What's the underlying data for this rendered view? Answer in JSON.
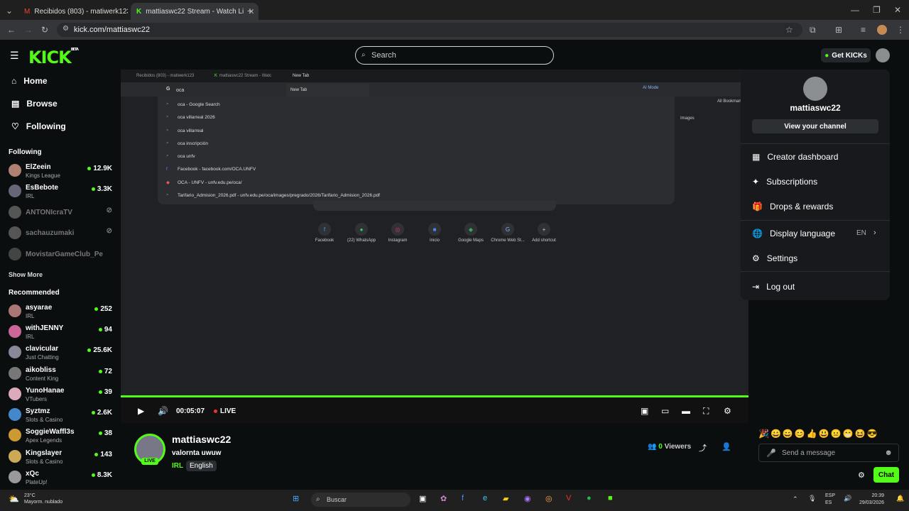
{
  "browser": {
    "tabs": [
      {
        "title": "Recibidos (803) - matiwerk123",
        "active": false
      },
      {
        "title": "mattiaswc22 Stream - Watch Li",
        "active": true
      }
    ],
    "url": "kick.com/mattiaswc22"
  },
  "kick": {
    "logo": "KICK",
    "logo_badge": "BETA",
    "search_placeholder": "Search",
    "get_kicks": "Get KICKs",
    "nav": [
      {
        "label": "Home",
        "icon": "home-icon"
      },
      {
        "label": "Browse",
        "icon": "browse-icon"
      },
      {
        "label": "Following",
        "icon": "heart-icon"
      }
    ],
    "following_header": "Following",
    "following": [
      {
        "name": "ElZeein",
        "category": "Kings League",
        "viewers": "12.9K",
        "live": true
      },
      {
        "name": "EsBebote",
        "category": "IRL",
        "viewers": "3.3K",
        "live": true
      },
      {
        "name": "ANTONIcraTV",
        "live": false
      },
      {
        "name": "sachauzumaki",
        "live": false
      },
      {
        "name": "MovistarGameClub_Pe",
        "live": false
      }
    ],
    "show_more": "Show More",
    "recommended_header": "Recommended",
    "recommended": [
      {
        "name": "asyarae",
        "category": "IRL",
        "viewers": "252"
      },
      {
        "name": "withJENNY",
        "category": "IRL",
        "viewers": "94"
      },
      {
        "name": "clavicular",
        "category": "Just Chatting",
        "viewers": "25.6K"
      },
      {
        "name": "aikobliss",
        "category": "Content King",
        "viewers": "72"
      },
      {
        "name": "YunoHanae",
        "category": "VTubers",
        "viewers": "39"
      },
      {
        "name": "Syztmz",
        "category": "Slots & Casino",
        "viewers": "2.6K"
      },
      {
        "name": "SoggieWaffl3s",
        "category": "Apex Legends",
        "viewers": "38"
      },
      {
        "name": "Kingslayer",
        "category": "Slots & Casino",
        "viewers": "143"
      },
      {
        "name": "xQc",
        "category": "PlateUp!",
        "viewers": "8.3K"
      }
    ]
  },
  "stream_capture": {
    "tabs": [
      "Recibidos (803) - matiwerk123",
      "mattiaswc22 Stream - Watc",
      "New Tab"
    ],
    "tooltip": "New Tab",
    "query": "oca",
    "ai_mode": "AI Mode",
    "suggestions": [
      {
        "text": "oca - Google Search",
        "icon": "search-icon"
      },
      {
        "text": "oca villarreal 2026",
        "icon": "search-icon"
      },
      {
        "text": "oca villarreal",
        "icon": "search-icon"
      },
      {
        "text": "oca inscripción",
        "icon": "search-icon"
      },
      {
        "text": "oca unfv",
        "icon": "search-icon"
      },
      {
        "text": "Facebook - facebook.com/OCA.UNFV",
        "icon": "facebook-icon"
      },
      {
        "text": "OCA - UNFV - unfv.edu.pe/oca/",
        "icon": "site-icon"
      },
      {
        "text": "Tarifario_Admision_2026.pdf - unfv.edu.pe/oca/images/pregrado/2026/Tarifario_Admision_2026.pdf",
        "icon": "search-icon"
      }
    ],
    "shortcuts": [
      "Facebook",
      "(22) WhatsApp",
      "Instagram",
      "Inicio",
      "Google Maps",
      "Chrome Web St...",
      "Add shortcut"
    ],
    "images_link": "Images",
    "bookmarks": "All Bookmarks"
  },
  "player": {
    "time": "00:05:07",
    "live_label": "LIVE",
    "progress_fraction": 1.0
  },
  "stream": {
    "name": "mattiaswc22",
    "title": "valornta uwuw",
    "category": "IRL",
    "language": "English",
    "live_badge": "LIVE",
    "viewers": "0",
    "viewers_label": "Viewers"
  },
  "chat": {
    "placeholder": "Send a message",
    "button": "Chat"
  },
  "user_menu": {
    "username": "mattiaswc22",
    "view_channel": "View your channel",
    "items": [
      {
        "label": "Creator dashboard",
        "icon": "dashboard-icon"
      },
      {
        "label": "Subscriptions",
        "icon": "sparkle-icon"
      },
      {
        "label": "Drops & rewards",
        "icon": "gift-icon"
      },
      {
        "label": "Display language",
        "icon": "globe-icon",
        "value": "EN"
      },
      {
        "label": "Settings",
        "icon": "gear-icon"
      },
      {
        "label": "Log out",
        "icon": "logout-icon"
      }
    ]
  },
  "taskbar": {
    "weather_temp": "23°C",
    "weather_desc": "Mayorm. nublado",
    "search": "Buscar",
    "lang1": "ESP",
    "lang2": "ES",
    "time": "20:39",
    "date": "29/03/2026"
  },
  "colors": {
    "accent": "#53fc18",
    "background": "#0b0e0f"
  }
}
